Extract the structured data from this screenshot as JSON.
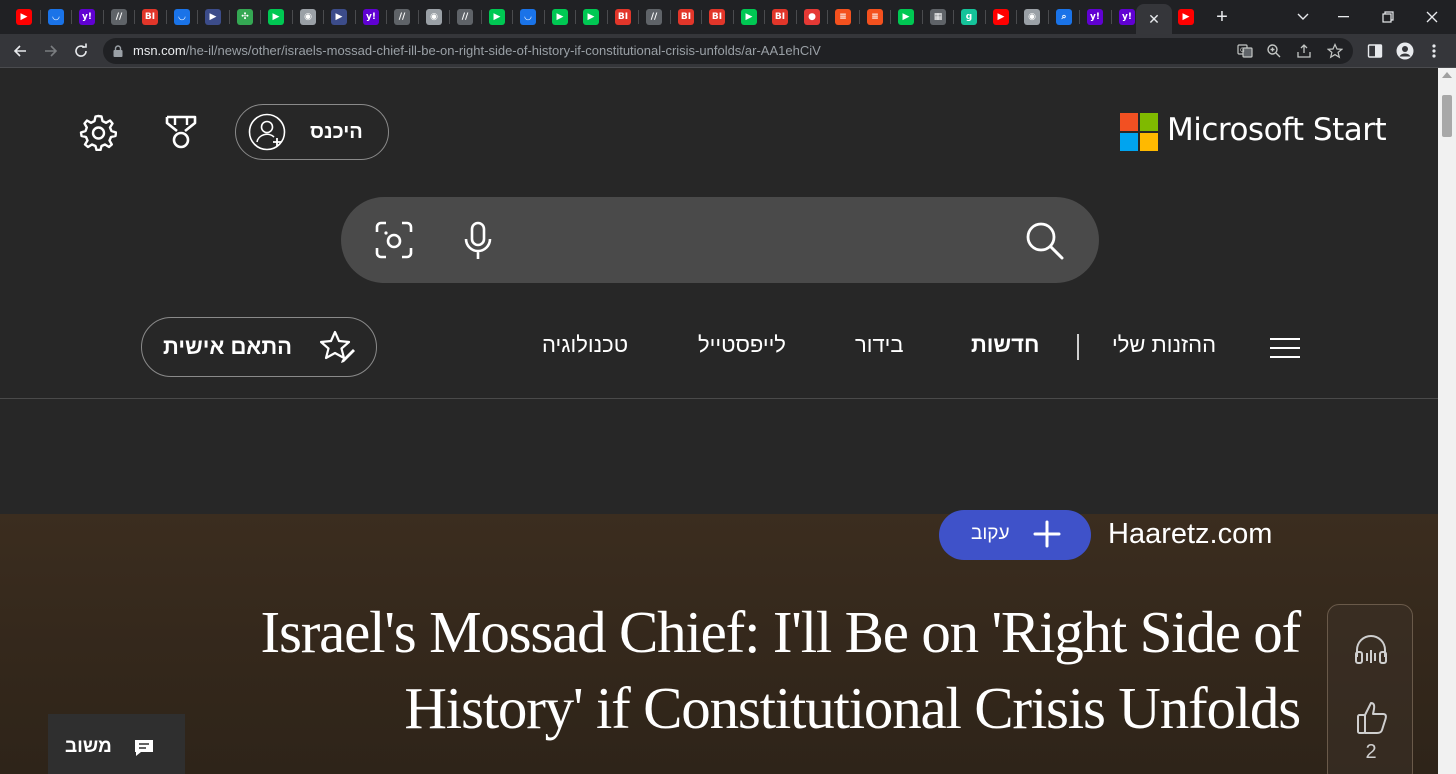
{
  "browser": {
    "tabs": [
      {
        "icon": "youtube-icon",
        "color": "#ff0000",
        "glyph": "▶"
      },
      {
        "icon": "shield-icon",
        "color": "#1a73e8",
        "glyph": "◡"
      },
      {
        "icon": "yahoo-icon",
        "color": "#6001d2",
        "glyph": "y!"
      },
      {
        "icon": "slash-icon",
        "color": "#5f6368",
        "glyph": "//"
      },
      {
        "icon": "business-insider-icon",
        "color": "#e2362a",
        "glyph": "BI"
      },
      {
        "icon": "shield-icon",
        "color": "#1a73e8",
        "glyph": "◡"
      },
      {
        "icon": "arrow-icon",
        "color": "#3c4c8a",
        "glyph": "▶"
      },
      {
        "icon": "map-icon",
        "color": "#34a853",
        "glyph": "✣"
      },
      {
        "icon": "play-icon",
        "color": "#00c853",
        "glyph": "▶"
      },
      {
        "icon": "globe-icon",
        "color": "#9aa0a6",
        "glyph": "◉"
      },
      {
        "icon": "arrow-icon",
        "color": "#3c4c8a",
        "glyph": "▶"
      },
      {
        "icon": "yahoo-icon",
        "color": "#6001d2",
        "glyph": "y!"
      },
      {
        "icon": "slash-icon",
        "color": "#5f6368",
        "glyph": "//"
      },
      {
        "icon": "globe-icon",
        "color": "#9aa0a6",
        "glyph": "◉"
      },
      {
        "icon": "slash-icon",
        "color": "#5f6368",
        "glyph": "//"
      },
      {
        "icon": "play-icon",
        "color": "#00c853",
        "glyph": "▶"
      },
      {
        "icon": "shield-icon",
        "color": "#1a73e8",
        "glyph": "◡"
      },
      {
        "icon": "play-icon",
        "color": "#00c853",
        "glyph": "▶"
      },
      {
        "icon": "play-icon",
        "color": "#00c853",
        "glyph": "▶"
      },
      {
        "icon": "business-insider-icon",
        "color": "#e2362a",
        "glyph": "BI"
      },
      {
        "icon": "slash-icon",
        "color": "#5f6368",
        "glyph": "//"
      },
      {
        "icon": "business-insider-icon",
        "color": "#e2362a",
        "glyph": "BI"
      },
      {
        "icon": "business-insider-icon",
        "color": "#e2362a",
        "glyph": "BI"
      },
      {
        "icon": "play-icon",
        "color": "#00c853",
        "glyph": "▶"
      },
      {
        "icon": "business-insider-icon",
        "color": "#e2362a",
        "glyph": "BI"
      },
      {
        "icon": "podcast-icon",
        "color": "#e53935",
        "glyph": "●"
      },
      {
        "icon": "bookmark-icon",
        "color": "#f4511e",
        "glyph": "≡"
      },
      {
        "icon": "bookmark-icon",
        "color": "#f4511e",
        "glyph": "≡"
      },
      {
        "icon": "play-icon",
        "color": "#00c853",
        "glyph": "▶"
      },
      {
        "icon": "news-icon",
        "color": "#5f6368",
        "glyph": "▦"
      },
      {
        "icon": "grammarly-icon",
        "color": "#15c39a",
        "glyph": "g"
      },
      {
        "icon": "youtube-icon",
        "color": "#ff0000",
        "glyph": "▶"
      },
      {
        "icon": "globe-icon",
        "color": "#9aa0a6",
        "glyph": "◉"
      },
      {
        "icon": "search-icon",
        "color": "#1a73e8",
        "glyph": "⌕"
      },
      {
        "icon": "yahoo-icon",
        "color": "#6001d2",
        "glyph": "y!"
      },
      {
        "icon": "yahoo-icon",
        "color": "#6001d2",
        "glyph": "y!"
      }
    ],
    "active_tab_close": "✕",
    "last_tab": {
      "icon": "youtube-icon",
      "color": "#ff0000",
      "glyph": "▶"
    },
    "new_tab": "+",
    "url_host": "msn.com",
    "url_path": "/he-il/news/other/israels-mossad-chief-ill-be-on-right-side-of-history-if-constitutional-crisis-unfolds/ar-AA1ehCiV"
  },
  "header": {
    "brand": "Microsoft Start",
    "signin_label": "היכנס"
  },
  "nav": {
    "my_feed": "ההזנות שלי",
    "news": "חדשות",
    "entertainment": "בידור",
    "lifestyle": "לייפסטייל",
    "technology": "טכנולוגיה",
    "personalize": "התאם אישית"
  },
  "article": {
    "source": "Haaretz.com",
    "follow_label": "עקוב",
    "headline": "Israel's Mossad Chief: I'll Be on 'Right Side of History' if Constitutional Crisis Unfolds",
    "like_count": "2"
  },
  "feedback": {
    "label": "משוב"
  },
  "colors": {
    "ms_red": "#f25022",
    "ms_green": "#7fba00",
    "ms_blue": "#00a4ef",
    "ms_yellow": "#ffb900",
    "follow_button": "#3f52c9"
  }
}
